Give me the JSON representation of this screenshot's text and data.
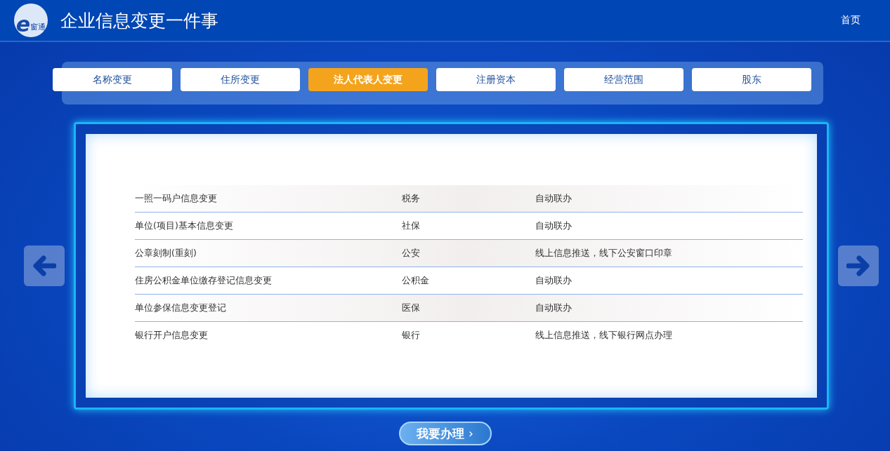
{
  "header": {
    "logo_letter": "e",
    "logo_text": "窗通",
    "title": "企业信息变更一件事",
    "home_link": "首页"
  },
  "tabs": [
    {
      "label": "名称变更",
      "selected": false
    },
    {
      "label": "住所变更",
      "selected": false
    },
    {
      "label": "法人代表人变更",
      "selected": true
    },
    {
      "label": "注册资本",
      "selected": false
    },
    {
      "label": "经营范围",
      "selected": false
    },
    {
      "label": "股东",
      "selected": false
    }
  ],
  "table": {
    "rows": [
      [
        "一照一码户信息变更",
        "税务",
        "自动联办"
      ],
      [
        "单位(项目)基本信息变更",
        "社保",
        "自动联办"
      ],
      [
        "公章刻制(重刻)",
        "公安",
        "线上信息推送，线下公安窗口印章"
      ],
      [
        "住房公积金单位缴存登记信息变更",
        "公积金",
        "自动联办"
      ],
      [
        "单位参保信息变更登记",
        "医保",
        "自动联办"
      ],
      [
        "银行开户信息变更",
        "银行",
        "线上信息推送，线下银行网点办理"
      ]
    ]
  },
  "action_button": {
    "label": "我要办理",
    "chevron": "›"
  }
}
